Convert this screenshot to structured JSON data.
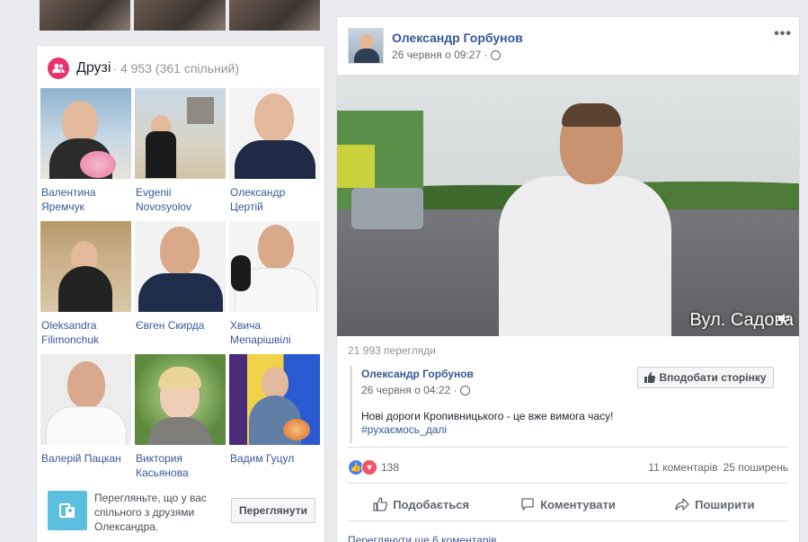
{
  "friends": {
    "title": "Друзі",
    "count": "· 4 953 (361 спільний)",
    "items": [
      {
        "name": "Валентина Яремчук"
      },
      {
        "name": "Evgenii Novosyolov"
      },
      {
        "name": "Олександр Цертій"
      },
      {
        "name": "Oleksandra Filimonchuk"
      },
      {
        "name": "Євген Скирда"
      },
      {
        "name": "Хвича Мепарішвілі"
      },
      {
        "name": "Валерій Пацкан"
      },
      {
        "name": "Виктория Касьянова"
      },
      {
        "name": "Вадим Гуцул"
      }
    ],
    "mutual_text": "Перегляньте, що у вас спільного з друзями Олександра.",
    "mutual_button": "Переглянути"
  },
  "post": {
    "author": "Олександр Горбунов",
    "date": "26 червня о 09:27 ·",
    "video_caption": "Вул. Садова",
    "views": "21 993 перегляди",
    "shared": {
      "author": "Олександр Горбунов",
      "date": "26 червня о 04:22 ·",
      "text": "Нові дороги Кропивницького - це вже вимога часу!",
      "hashtag": "#рухаємось_далі",
      "like_page_button": "Вподобати сторінку"
    },
    "reactions_count": "138",
    "comments": "11 коментарів",
    "shares": "25 поширень",
    "actions": {
      "like": "Подобається",
      "comment": "Коментувати",
      "share": "Поширити"
    },
    "more_comments": "Переглянути ще 6 коментарів"
  }
}
